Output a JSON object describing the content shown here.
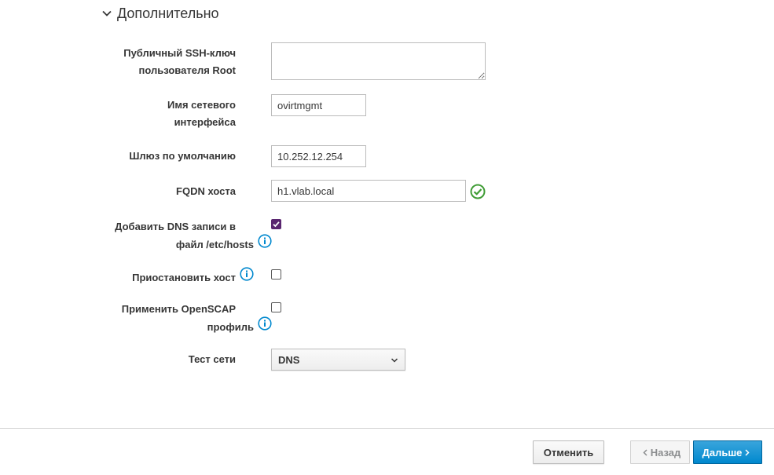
{
  "section": {
    "title": "Дополнительно",
    "expanded_icon": "chevron-down-icon"
  },
  "fields": {
    "ssh_key": {
      "label_line1": "Публичный SSH-ключ",
      "label_line2": "пользователя Root",
      "value": ""
    },
    "nic_name": {
      "label_line1": "Имя сетевого",
      "label_line2": "интерфейса",
      "value": "ovirtmgmt"
    },
    "gateway": {
      "label": "Шлюз по умолчанию",
      "value": "10.252.12.254"
    },
    "fqdn": {
      "label": "FQDN хоста",
      "value": "h1.vlab.local",
      "status_icon": "check-circle-icon",
      "status_color": "#3f9c35"
    },
    "add_dns": {
      "label_line1": "Добавить DNS записи в",
      "label_line2": "файл /etc/hosts",
      "checked": true,
      "info_icon": "info-icon"
    },
    "pause_host": {
      "label": "Приостановить хост",
      "checked": false,
      "info_icon": "info-icon"
    },
    "openscap": {
      "label_line1": "Применить OpenSCAP",
      "label_line2": "профиль",
      "checked": false,
      "info_icon": "info-icon"
    },
    "network_test": {
      "label": "Тест сети",
      "selected": "DNS"
    }
  },
  "footer": {
    "cancel_label": "Отменить",
    "back_label": "Назад",
    "next_label": "Дальше"
  },
  "colors": {
    "primary": "#0088ce",
    "checkbox_checked": "#5a2670",
    "info_icon": "#0088ce",
    "ok": "#3f9c35"
  }
}
